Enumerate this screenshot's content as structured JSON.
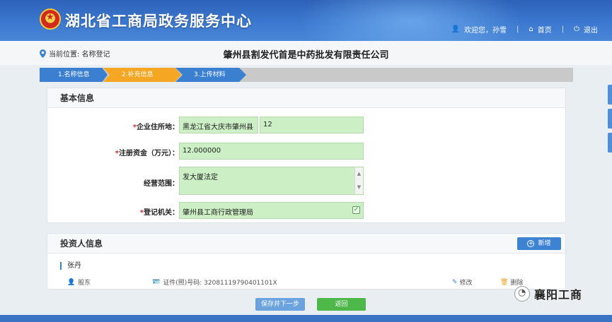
{
  "header": {
    "site_title": "湖北省工商局政务服务中心",
    "welcome": "欢迎您，孙雪",
    "home": "首页",
    "logout": "退出",
    "separator": "|"
  },
  "location": {
    "label": "当前位置: 名称登记",
    "company_name": "肇州县割发代首是中药批发有限责任公司"
  },
  "steps": [
    {
      "label": "1.名称信息"
    },
    {
      "label": "2.补充信息"
    },
    {
      "label": "3.上传材料"
    }
  ],
  "basic_info": {
    "title": "基本信息",
    "address_label": "企业住所地：",
    "address_region": "黑龙江省大庆市肇州县",
    "address_detail": "12",
    "capital_label": "注册资金（万元）：",
    "capital_value": "12.000000",
    "scope_label": "经营范围：",
    "scope_value": "发大厦法定",
    "authority_label": "登记机关：",
    "authority_value": "肇州县工商行政管理局",
    "required_mark": "*"
  },
  "investor_info": {
    "title": "投资人信息",
    "add_label": "新增",
    "person_name": "张丹",
    "role": "股东",
    "id_text": "证件(照)号码: 32081119790401101X",
    "edit_label": "修改",
    "delete_label": "删除"
  },
  "actions": {
    "save_next": "保存并下一步",
    "back": "返回"
  },
  "watermark": {
    "text": "襄阳工商"
  },
  "colors": {
    "header_blue": "#3b78cf",
    "step_active": "#f5a623",
    "step_blue": "#3b7fd0",
    "field_green": "#ccefc5",
    "button_green": "#4eb84a"
  }
}
